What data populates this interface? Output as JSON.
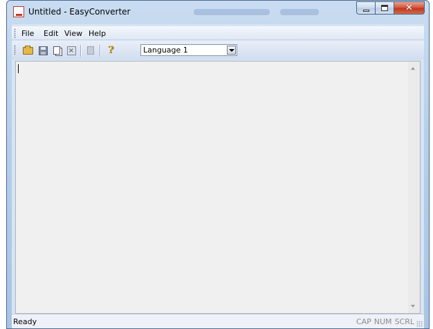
{
  "window": {
    "title": "Untitled - EasyConverter"
  },
  "menu": {
    "file": "File",
    "edit": "Edit",
    "view": "View",
    "help": "Help"
  },
  "toolbar": {
    "buttons": [
      "open-icon",
      "save-icon",
      "copy-icon",
      "close-document-icon",
      "paste-icon",
      "help-icon"
    ],
    "language": {
      "selected": "Language 1"
    }
  },
  "editor": {
    "text": ""
  },
  "status": {
    "text": "Ready",
    "cap": "CAP",
    "num": "NUM",
    "scrl": "SCRL"
  }
}
